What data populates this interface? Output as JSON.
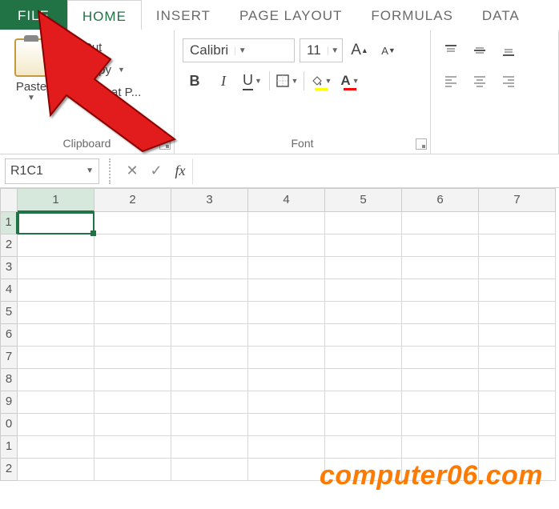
{
  "tabs": {
    "file": "FILE",
    "home": "HOME",
    "insert": "INSERT",
    "page_layout": "PAGE LAYOUT",
    "formulas": "FORMULAS",
    "data": "DATA"
  },
  "clipboard": {
    "paste": "Paste",
    "cut": "Cut",
    "copy": "Copy",
    "format_painter": "Format P...",
    "group_label": "Clipboard"
  },
  "font": {
    "name": "Calibri",
    "size": "11",
    "group_label": "Font"
  },
  "formula_bar": {
    "name_box": "R1C1",
    "fx_label": "fx",
    "value": ""
  },
  "grid": {
    "columns": [
      "1",
      "2",
      "3",
      "4",
      "5",
      "6",
      "7"
    ],
    "rows": [
      "1",
      "2",
      "3",
      "4",
      "5",
      "6",
      "7",
      "8",
      "9",
      "0",
      "1",
      "2"
    ],
    "active_cell": {
      "row": 0,
      "col": 0
    }
  },
  "watermark": "computer06.com",
  "icons": {
    "bold": "B",
    "italic": "I",
    "underline": "U",
    "fx_cancel": "✕",
    "fx_enter": "✓",
    "grow_font": "A",
    "shrink_font": "A"
  },
  "colors": {
    "fill": "#ffff00",
    "font_color": "#ff0000",
    "accent": "#217346"
  }
}
